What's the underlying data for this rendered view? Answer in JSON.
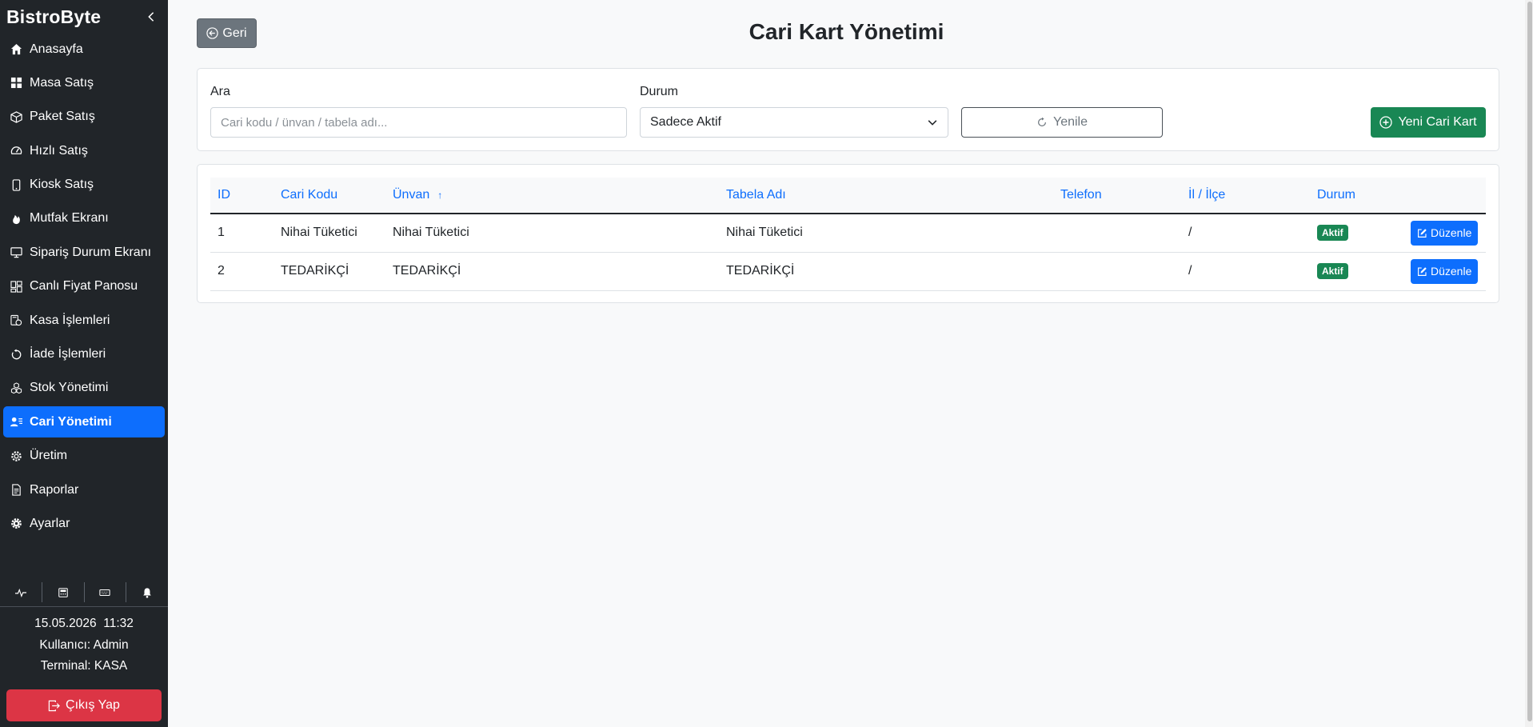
{
  "sidebar": {
    "brand": "BistroByte",
    "items": [
      {
        "label": "Anasayfa",
        "icon": "house-icon",
        "active": false
      },
      {
        "label": "Masa Satış",
        "icon": "grid-icon",
        "active": false
      },
      {
        "label": "Paket Satış",
        "icon": "box-icon",
        "active": false
      },
      {
        "label": "Hızlı Satış",
        "icon": "speedometer-icon",
        "active": false
      },
      {
        "label": "Kiosk Satış",
        "icon": "tablet-icon",
        "active": false
      },
      {
        "label": "Mutfak Ekranı",
        "icon": "fire-icon",
        "active": false
      },
      {
        "label": "Sipariş Durum Ekranı",
        "icon": "monitor-icon",
        "active": false
      },
      {
        "label": "Canlı Fiyat Panosu",
        "icon": "dashboard-icon",
        "active": false
      },
      {
        "label": "Kasa İşlemleri",
        "icon": "cash-register-icon",
        "active": false
      },
      {
        "label": "İade İşlemleri",
        "icon": "return-icon",
        "active": false
      },
      {
        "label": "Stok Yönetimi",
        "icon": "boxes-icon",
        "active": false
      },
      {
        "label": "Cari Yönetimi",
        "icon": "person-lines-icon",
        "active": true
      },
      {
        "label": "Üretim",
        "icon": "gear-wide-icon",
        "active": false
      },
      {
        "label": "Raporlar",
        "icon": "file-text-icon",
        "active": false
      },
      {
        "label": "Ayarlar",
        "icon": "gear-icon",
        "active": false
      }
    ],
    "datetime": "15.05.2026  11:32",
    "user": "Kullanıcı: Admin",
    "terminal": "Terminal: KASA",
    "logout_label": "Çıkış Yap"
  },
  "header": {
    "back_label": "Geri",
    "title": "Cari Kart Yönetimi"
  },
  "filters": {
    "search_label": "Ara",
    "search_placeholder": "Cari kodu / ünvan / tabela adı...",
    "status_label": "Durum",
    "status_value": "Sadece Aktif",
    "refresh_label": "Yenile",
    "new_label": "Yeni Cari Kart"
  },
  "table": {
    "columns": [
      "ID",
      "Cari Kodu",
      "Ünvan",
      "Tabela Adı",
      "Telefon",
      "İl / İlçe",
      "Durum"
    ],
    "rows": [
      {
        "id": "1",
        "code": "Nihai Tüketici",
        "title": "Nihai Tüketici",
        "sign": "Nihai Tüketici",
        "phone": "",
        "city": "/",
        "status": "Aktif",
        "edit": "Düzenle"
      },
      {
        "id": "2",
        "code": "TEDARİKÇİ",
        "title": "TEDARİKÇİ",
        "sign": "TEDARİKÇİ",
        "phone": "",
        "city": "/",
        "status": "Aktif",
        "edit": "Düzenle"
      }
    ]
  },
  "colors": {
    "sidebar_bg": "#212529",
    "primary": "#0d6efd",
    "success": "#198754",
    "danger": "#dc3545",
    "secondary": "#6c757d"
  }
}
